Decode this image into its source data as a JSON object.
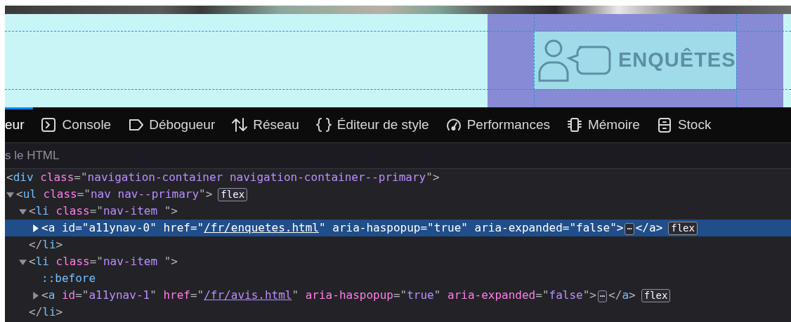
{
  "banner": {
    "nav_item": {
      "label": "ENQUÊTES"
    }
  },
  "devtools": {
    "tabs": [
      {
        "label": "eur",
        "selected": true
      },
      {
        "label": "Console",
        "kind": "console",
        "selected": false
      },
      {
        "label": "Débogueur",
        "kind": "debugger",
        "selected": false
      },
      {
        "label": "Réseau",
        "kind": "network",
        "selected": false
      },
      {
        "label": "Éditeur de style",
        "kind": "style",
        "selected": false
      },
      {
        "label": "Performances",
        "kind": "performance",
        "selected": false
      },
      {
        "label": "Mémoire",
        "kind": "memory",
        "selected": false
      },
      {
        "label": "Stock",
        "kind": "storage",
        "selected": false
      }
    ],
    "search": {
      "placeholder": "s le HTML"
    },
    "tree": {
      "tokens": [
        {
          "kind": "p",
          "t": "<"
        },
        {
          "kind": "tag",
          "t": "div"
        },
        {
          "kind": "attr",
          "t": " class"
        },
        {
          "kind": "p",
          "t": "=\""
        },
        {
          "kind": "val",
          "t": "navigation-container navigation-container--primary"
        },
        {
          "kind": "p",
          "t": "\">"
        }
      ],
      "children": [
        {
          "tokens": [
            {
              "kind": "p",
              "t": "<"
            },
            {
              "kind": "tag",
              "t": "ul"
            },
            {
              "kind": "attr",
              "t": " class"
            },
            {
              "kind": "p",
              "t": "=\""
            },
            {
              "kind": "val",
              "t": "nav nav--primary"
            },
            {
              "kind": "p",
              "t": "\">"
            }
          ],
          "badge": "flex",
          "expanded": true,
          "selected": false,
          "children": [
            {
              "tokens": [
                {
                  "kind": "p",
                  "t": "<"
                },
                {
                  "kind": "tag",
                  "t": "li"
                },
                {
                  "kind": "attr",
                  "t": " class"
                },
                {
                  "kind": "p",
                  "t": "=\""
                },
                {
                  "kind": "val",
                  "t": "nav-item "
                },
                {
                  "kind": "p",
                  "t": "\">"
                }
              ],
              "expanded": true,
              "selected": false,
              "closing": [
                {
                  "kind": "p",
                  "t": "</"
                },
                {
                  "kind": "tag",
                  "t": "li"
                },
                {
                  "kind": "p",
                  "t": ">"
                }
              ],
              "children": [
                {
                  "tokens": [
                    {
                      "kind": "p",
                      "t": "<"
                    },
                    {
                      "kind": "tag",
                      "t": "a"
                    },
                    {
                      "kind": "attr",
                      "t": " id"
                    },
                    {
                      "kind": "p",
                      "t": "=\""
                    },
                    {
                      "kind": "val",
                      "t": "a11ynav-0"
                    },
                    {
                      "kind": "p",
                      "t": "\" "
                    },
                    {
                      "kind": "attr",
                      "t": "href"
                    },
                    {
                      "kind": "p",
                      "t": "=\""
                    },
                    {
                      "kind": "link",
                      "t": "/fr/enquetes.html"
                    },
                    {
                      "kind": "p",
                      "t": "\" "
                    },
                    {
                      "kind": "attr",
                      "t": "aria-haspopup"
                    },
                    {
                      "kind": "p",
                      "t": "=\""
                    },
                    {
                      "kind": "val",
                      "t": "true"
                    },
                    {
                      "kind": "p",
                      "t": "\" "
                    },
                    {
                      "kind": "attr",
                      "t": "aria-expanded"
                    },
                    {
                      "kind": "p",
                      "t": "=\""
                    },
                    {
                      "kind": "val",
                      "t": "false"
                    },
                    {
                      "kind": "p",
                      "t": "\">"
                    },
                    {
                      "kind": "more",
                      "t": "⋯"
                    },
                    {
                      "kind": "p",
                      "t": "</"
                    },
                    {
                      "kind": "tag",
                      "t": "a"
                    },
                    {
                      "kind": "p",
                      "t": ">"
                    }
                  ],
                  "badge": "flex",
                  "expanded": false,
                  "selected": true
                }
              ]
            },
            {
              "tokens": [
                {
                  "kind": "p",
                  "t": "<"
                },
                {
                  "kind": "tag",
                  "t": "li"
                },
                {
                  "kind": "attr",
                  "t": " class"
                },
                {
                  "kind": "p",
                  "t": "=\""
                },
                {
                  "kind": "val",
                  "t": "nav-item "
                },
                {
                  "kind": "p",
                  "t": "\">"
                }
              ],
              "expanded": true,
              "selected": false,
              "closing": [
                {
                  "kind": "p",
                  "t": "</"
                },
                {
                  "kind": "tag",
                  "t": "li"
                },
                {
                  "kind": "p",
                  "t": ">"
                }
              ],
              "children": [
                {
                  "tokens": [
                    {
                      "kind": "pseudo",
                      "t": "::before"
                    }
                  ],
                  "selected": false
                },
                {
                  "tokens": [
                    {
                      "kind": "p",
                      "t": "<"
                    },
                    {
                      "kind": "tag",
                      "t": "a"
                    },
                    {
                      "kind": "attr",
                      "t": " id"
                    },
                    {
                      "kind": "p",
                      "t": "=\""
                    },
                    {
                      "kind": "val",
                      "t": "a11ynav-1"
                    },
                    {
                      "kind": "p",
                      "t": "\" "
                    },
                    {
                      "kind": "attr",
                      "t": "href"
                    },
                    {
                      "kind": "p",
                      "t": "=\""
                    },
                    {
                      "kind": "link",
                      "t": "/fr/avis.html"
                    },
                    {
                      "kind": "p",
                      "t": "\" "
                    },
                    {
                      "kind": "attr",
                      "t": "aria-haspopup"
                    },
                    {
                      "kind": "p",
                      "t": "=\""
                    },
                    {
                      "kind": "val",
                      "t": "true"
                    },
                    {
                      "kind": "p",
                      "t": "\" "
                    },
                    {
                      "kind": "attr",
                      "t": "aria-expanded"
                    },
                    {
                      "kind": "p",
                      "t": "=\""
                    },
                    {
                      "kind": "val",
                      "t": "false"
                    },
                    {
                      "kind": "p",
                      "t": "\">"
                    },
                    {
                      "kind": "more",
                      "t": "⋯"
                    },
                    {
                      "kind": "p",
                      "t": "</"
                    },
                    {
                      "kind": "tag",
                      "t": "a"
                    },
                    {
                      "kind": "p",
                      "t": ">"
                    }
                  ],
                  "badge": "flex",
                  "expanded": false,
                  "selected": false
                }
              ]
            }
          ]
        }
      ]
    }
  }
}
